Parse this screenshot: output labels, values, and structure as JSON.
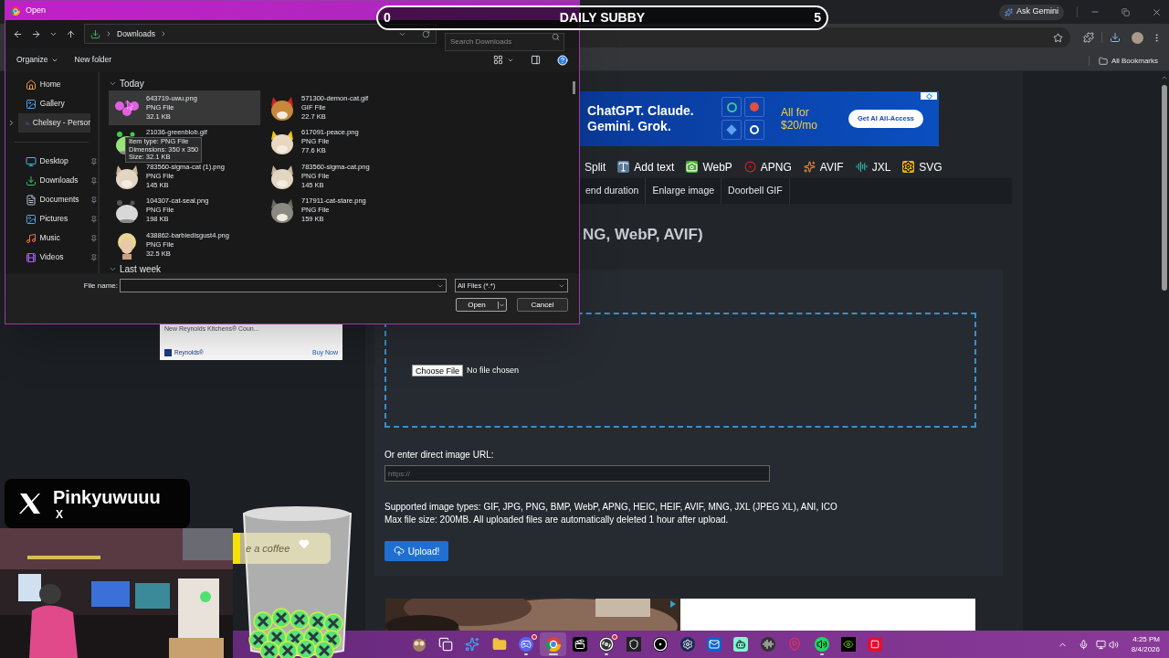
{
  "browser": {
    "ask_gemini": "Ask Gemini",
    "bookmarks": [
      "All Bookmarks"
    ]
  },
  "page": {
    "side_ad": {
      "title": "New Reynolds Kitchens® Coun...",
      "brand": "Reynolds®",
      "cta": "Buy Now"
    },
    "banner": {
      "headline": "ChatGPT. Claude. Gemini. Grok.",
      "offer": "All for $20/mo",
      "cta": "Get AI All-Access"
    },
    "tools": [
      {
        "label": "Split",
        "kind": "split"
      },
      {
        "label": "Add text",
        "kind": "text"
      },
      {
        "label": "WebP",
        "kind": "webp"
      },
      {
        "label": "APNG",
        "kind": "apng"
      },
      {
        "label": "AVIF",
        "kind": "avif"
      },
      {
        "label": "JXL",
        "kind": "jxl"
      },
      {
        "label": "SVG",
        "kind": "svg"
      }
    ],
    "subnav": [
      "end duration",
      "Enlarge image",
      "Doorbell GIF"
    ],
    "heading": "NG, WebP, AVIF)",
    "upload": {
      "choose": "Choose File",
      "status": "No file chosen",
      "url_label": "Or enter direct image URL:",
      "url_placeholder": "https://",
      "notes": [
        "Supported image types: GIF, JPG, PNG, BMP, WebP, APNG, HEIC, HEIF, AVIF, MNG, JXL (JPEG XL), ANI, ICO",
        "Max file size: 200MB. All uploaded files are automatically deleted 1 hour after upload."
      ],
      "button": "Upload!"
    }
  },
  "dialog": {
    "title": "Open",
    "breadcrumb": [
      "Downloads"
    ],
    "search": {
      "placeholder": "Search Downloads"
    },
    "toolbar": [
      "Organize",
      "New folder"
    ],
    "sidebar": [
      {
        "label": "Home",
        "kind": "home",
        "selected": false,
        "pinned": false
      },
      {
        "label": "Gallery",
        "kind": "gallery",
        "selected": false,
        "pinned": false
      },
      {
        "label": "Chelsey - Persor",
        "kind": "cloud",
        "selected": true,
        "pinned": false
      },
      {
        "label": "Desktop",
        "kind": "desktop",
        "selected": false,
        "pinned": true
      },
      {
        "label": "Downloads",
        "kind": "downloads",
        "selected": false,
        "pinned": true
      },
      {
        "label": "Documents",
        "kind": "documents",
        "selected": false,
        "pinned": true
      },
      {
        "label": "Pictures",
        "kind": "pictures",
        "selected": false,
        "pinned": true
      },
      {
        "label": "Music",
        "kind": "music",
        "selected": false,
        "pinned": true
      },
      {
        "label": "Videos",
        "kind": "videos",
        "selected": false,
        "pinned": true
      }
    ],
    "groups": [
      {
        "label": "Today",
        "files": [
          {
            "name": "643719-uwu.png",
            "type": "PNG File",
            "size": "32.1 KB",
            "selected": true
          },
          {
            "name": "571300-demon-cat.gif",
            "type": "GIF File",
            "size": "22.7 KB",
            "selected": false
          },
          {
            "name": "21036-greenblob.gif",
            "selected": false
          },
          {
            "name": "617091-peace.png",
            "type": "PNG File",
            "size": "77.6 KB",
            "selected": false
          },
          {
            "name": "783560-sigma-cat (1).png",
            "type": "PNG File",
            "size": "145 KB",
            "selected": false
          },
          {
            "name": "783560-sigma-cat.png",
            "type": "PNG File",
            "size": "145 KB",
            "selected": false
          },
          {
            "name": "104307-cat-seal.png",
            "type": "PNG File",
            "size": "198 KB",
            "selected": false
          },
          {
            "name": "717911-cat-stare.png",
            "type": "PNG File",
            "size": "159 KB",
            "selected": false
          },
          {
            "name": "438862-barbiedisgust4.png",
            "type": "PNG File",
            "size": "32.5 KB",
            "selected": false
          }
        ]
      },
      {
        "label": "Last week"
      }
    ],
    "tooltip": [
      "Item type: PNG File",
      "Dimensions: 350 x 350",
      "Size: 32.1 KB"
    ],
    "file_name_label": "File name:",
    "filter": "All Files (*.*)",
    "buttons": [
      "Open",
      "Cancel"
    ]
  },
  "overlay": {
    "goal": {
      "current": "0",
      "title": "DAILY SUBBY",
      "target": "5"
    },
    "social": {
      "handle": "Pinkyuwuuu",
      "platform": "X"
    },
    "coffee": "e a coffee"
  },
  "taskbar": {
    "apps": [
      {
        "kind": "owl",
        "running": false,
        "notification": false,
        "selected": false
      },
      {
        "kind": "taskview",
        "running": false,
        "notification": false,
        "selected": false
      },
      {
        "kind": "copilot",
        "running": false,
        "notification": false,
        "selected": false
      },
      {
        "kind": "folder",
        "running": false,
        "notification": false,
        "selected": false
      },
      {
        "kind": "chat",
        "running": true,
        "notification": true,
        "selected": false
      },
      {
        "kind": "browser",
        "running": true,
        "notification": false,
        "selected": true
      },
      {
        "kind": "editor",
        "running": false,
        "notification": false,
        "selected": false
      },
      {
        "kind": "recorder",
        "running": true,
        "notification": true,
        "selected": false
      },
      {
        "kind": "store",
        "running": false,
        "notification": false,
        "selected": false
      },
      {
        "kind": "mouse",
        "running": false,
        "notification": false,
        "selected": false
      },
      {
        "kind": "games",
        "running": false,
        "notification": false,
        "selected": false
      },
      {
        "kind": "mail",
        "running": false,
        "notification": false,
        "selected": false
      },
      {
        "kind": "bot",
        "running": false,
        "notification": false,
        "selected": false
      },
      {
        "kind": "audio",
        "running": false,
        "notification": false,
        "selected": false
      },
      {
        "kind": "pin",
        "running": false,
        "notification": false,
        "selected": false
      },
      {
        "kind": "music",
        "running": true,
        "notification": false,
        "selected": false
      },
      {
        "kind": "gpu",
        "running": false,
        "notification": false,
        "selected": false
      },
      {
        "kind": "record",
        "running": false,
        "notification": false,
        "selected": false
      }
    ],
    "time": "4:25 PM",
    "date": "8/4/2026"
  }
}
